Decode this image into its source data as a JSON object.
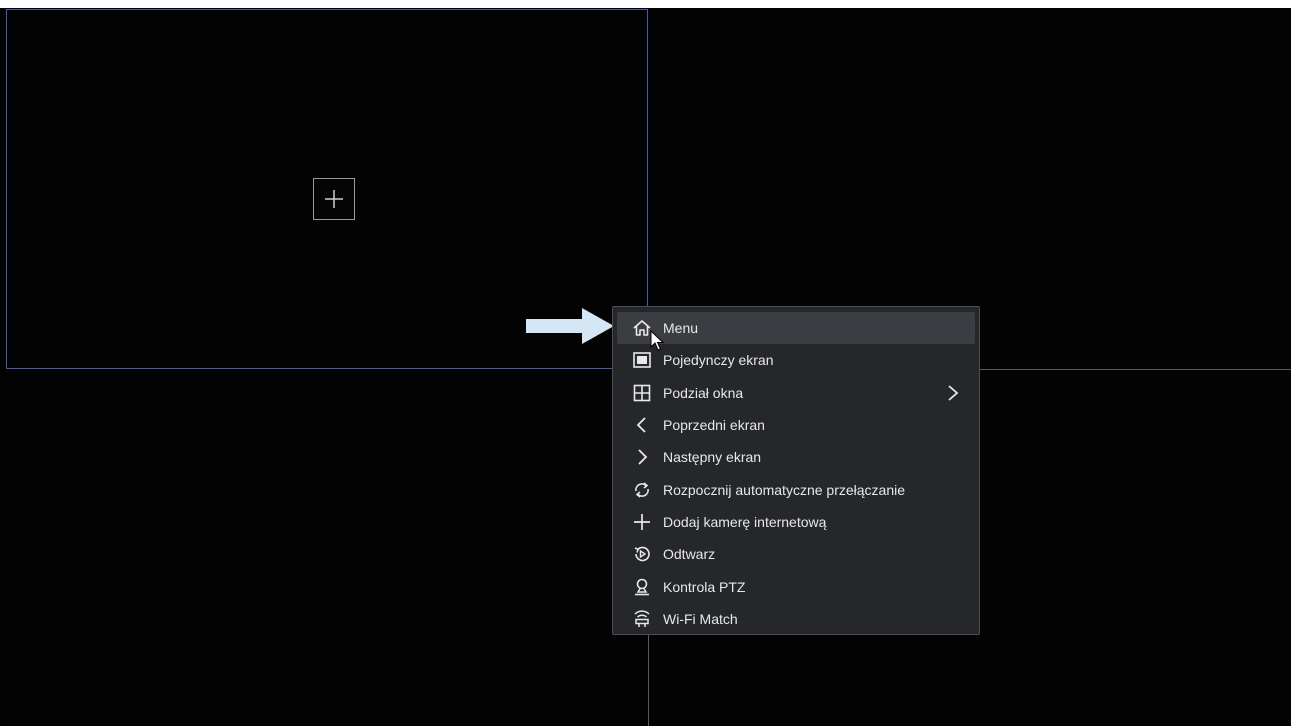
{
  "menu": {
    "items": [
      {
        "label": "Menu",
        "icon": "home-icon"
      },
      {
        "label": "Pojedynczy ekran",
        "icon": "single-screen-icon"
      },
      {
        "label": "Podział okna",
        "icon": "split-window-icon",
        "has_submenu": true
      },
      {
        "label": "Poprzedni ekran",
        "icon": "chevron-left-icon"
      },
      {
        "label": "Następny ekran",
        "icon": "chevron-right-icon"
      },
      {
        "label": "Rozpocznij automatyczne przełączanie",
        "icon": "cycle-icon"
      },
      {
        "label": "Dodaj kamerę internetową",
        "icon": "plus-icon"
      },
      {
        "label": "Odtwarz",
        "icon": "playback-icon"
      },
      {
        "label": "Kontrola PTZ",
        "icon": "ptz-icon"
      },
      {
        "label": "Wi-Fi Match",
        "icon": "wifi-match-icon"
      }
    ],
    "active_index": 0
  },
  "colors": {
    "background": "#020202",
    "pane_border_selected": "#4a5aa8",
    "menu_bg": "#25272b",
    "menu_active_bg": "#3b3d42",
    "menu_text": "#e8e8e8",
    "arrow": "#d5e6f5"
  }
}
